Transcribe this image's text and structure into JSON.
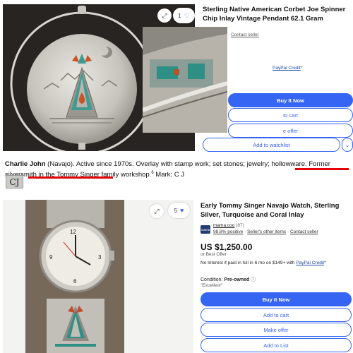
{
  "listing1": {
    "title": "Sterling Native American Corbet Joe Spinner Chip Inlay Vintage Pendant 62.1 Gram",
    "image_counter": "1",
    "contact_seller": "Contact seller",
    "credit_link": "PayPal Credit",
    "credit_suffix": "*",
    "buttons": {
      "buy": "Buy It Now",
      "cart": "to cart",
      "offer": "e offer",
      "watch": "Add to watchlist"
    },
    "icons": [
      "expand-icon",
      "heart-icon",
      "chevron-down-icon"
    ]
  },
  "bio": {
    "name": "Charlie John",
    "text_a": " (Navajo). Active since 1970s. Overlay with stamp work; set stones; jewelry; hollowware. ",
    "highlight_a": "Former silversmith",
    "text_b": " in the Tommy Singer family workshop.",
    "footnote": "6",
    "mark": " Mark: C J",
    "hallmark": "CJ"
  },
  "listing2": {
    "title": "Early Tommy Singer Navajo Watch, Sterling Silver, Turquoise and Coral Inlay",
    "image_counter": "5",
    "seller": {
      "avatar_text": "mama",
      "name": "mama.coo",
      "count": "(87)",
      "positive": "98.8% positive",
      "other_items": "Seller's other items",
      "contact": "Contact seller",
      "sep": "·"
    },
    "price": "US $1,250.00",
    "or_best_offer": "or Best Offer",
    "interest_text": "No Interest if paid in full in 6 mo on $149+ with ",
    "interest_link": "PayPal Credit",
    "interest_suffix": "*",
    "condition_label": "Condition:",
    "condition_value": "Pre-owned",
    "condition_note": "\"Excellent\"",
    "buttons": {
      "buy": "Buy It Now",
      "cart": "Add to cart",
      "offer": "Make offer",
      "list": "Add to List"
    }
  },
  "colors": {
    "accent": "#3665f3",
    "highlight": "#e60000",
    "link": "#1a47a6"
  }
}
